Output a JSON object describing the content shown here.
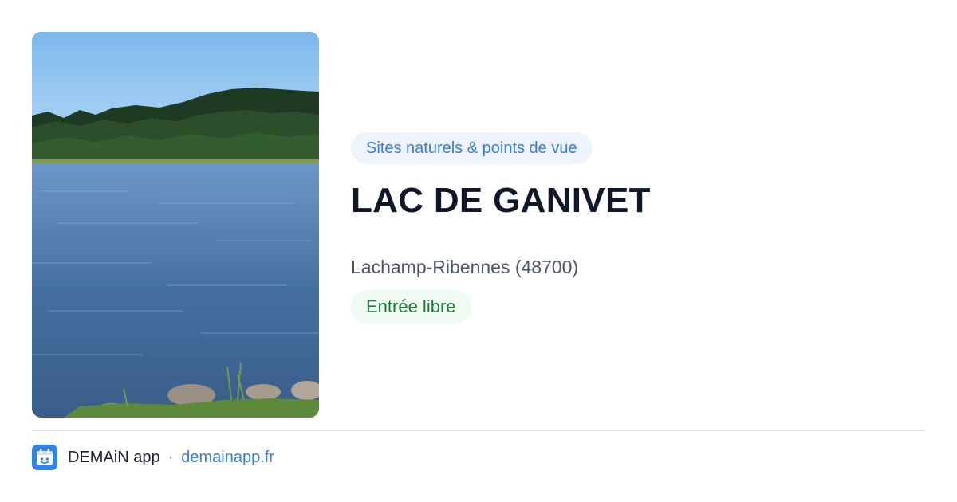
{
  "photo": {
    "alt": "Lac de Ganivet",
    "subject": "lake-landscape-photo"
  },
  "category": {
    "label": "Sites naturels & points de vue"
  },
  "place": {
    "title": "LAC DE GANIVET",
    "location": "Lachamp-Ribennes (48700)"
  },
  "access": {
    "label": "Entrée libre"
  },
  "footer": {
    "app_name": "DEMAiN app",
    "separator": "·",
    "link_text": "demainapp.fr",
    "logo_icon": "demain-app-logo-icon"
  },
  "colors": {
    "accent_blue": "#3a7bd5",
    "accent_green": "#1d7a3c",
    "title": "#0f1729"
  }
}
